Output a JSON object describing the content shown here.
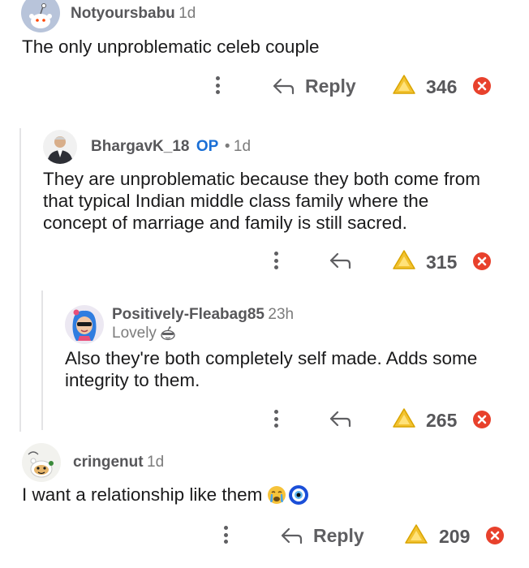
{
  "comments": [
    {
      "username": "Notyoursbabu",
      "age": "1d",
      "body": "The only unproblematic celeb couple",
      "reply_label": "Reply",
      "score": "346"
    },
    {
      "username": "BhargavK_18",
      "op_badge": "OP",
      "separator": "•",
      "age": "1d",
      "body": "They are unproblematic because they both come from that typical Indian middle class family where the concept of marriage and family is still sacred.",
      "score": "315"
    },
    {
      "username": "Positively-Fleabag85",
      "age": "23h",
      "flair": "Lovely",
      "body": "Also they're both completely self made. Adds some integrity to them.",
      "score": "265"
    },
    {
      "username": "cringenut",
      "age": "1d",
      "body": "I want a relationship like them",
      "reply_label": "Reply",
      "score": "209"
    }
  ],
  "icons": {
    "more": "more-options-icon",
    "reply": "reply-arrow-icon",
    "award": "award-icon",
    "close": "close-icon"
  },
  "colors": {
    "award_gold": "#f2c230",
    "close_red": "#e8412c",
    "op_blue": "#1a6fd6"
  }
}
